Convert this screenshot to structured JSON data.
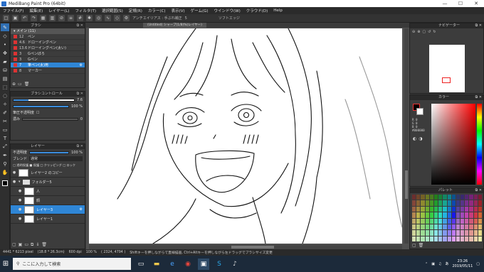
{
  "window": {
    "title": "MediBang Paint Pro (64bit)",
    "minimize": "—",
    "maximize": "☐",
    "close": "✕"
  },
  "menu": [
    "ファイル(F)",
    "編集(E)",
    "レイヤー(L)",
    "フィルタ(T)",
    "選択範囲(S)",
    "定規(R)",
    "カラー(C)",
    "表示(V)",
    "ゲーム(G)",
    "ウインドウ(W)",
    "クラウド(D)",
    "Help"
  ],
  "toolbar": {
    "antialias_label": "アンチエイリアス : 手ぶれ補正",
    "antialias_value": "5",
    "soft_edge_label": "ソフトエッジ"
  },
  "canvas": {
    "tab_label": "(Untitled) シャープ(1/8)%(レイヤー)"
  },
  "brush_panel": {
    "title": "ブラシ",
    "folder": "メイン (11)",
    "items": [
      {
        "size": "12",
        "name": "ペン"
      },
      {
        "size": "4.6",
        "name": "ドローイングペン"
      },
      {
        "size": "13.6",
        "name": "ドローイングペン(太い)"
      },
      {
        "size": "3",
        "name": "Gペンぼろ"
      },
      {
        "size": "3",
        "name": "Gペン"
      },
      {
        "size": "7",
        "name": "筆ペン(太)用"
      },
      {
        "size": "8",
        "name": "マーカー"
      }
    ]
  },
  "brush_control": {
    "title": "ブラシコントロール",
    "size_value": "7.6",
    "opacity_value": "100 %",
    "pressure_label": "筆圧不透明度",
    "thickness_label": "濃み",
    "thickness_value": "0",
    "size_fill": 0.25,
    "opacity_fill": 1.0
  },
  "layer_panel": {
    "title": "レイヤー",
    "opacity_label": "不透明度",
    "opacity_value": "100 %",
    "blend_label": "ブレンド",
    "blend_value": "通常",
    "options": "□ 透明保護  ■ 保護  □ クリッピング  □ ロック",
    "layers": [
      {
        "name": "レイヤー2 のコピー",
        "selected": false
      },
      {
        "name": "フォルダー5",
        "selected": false
      },
      {
        "name": "人",
        "selected": false
      },
      {
        "name": "顔",
        "selected": false
      },
      {
        "name": "レイヤー3",
        "selected": true
      },
      {
        "name": "レイヤー1",
        "selected": false
      }
    ]
  },
  "navigator": {
    "title": "ナビゲーター"
  },
  "color_panel": {
    "title": "カラー",
    "values": "R 0\nG 0\nB 0\n#000000"
  },
  "palette_panel": {
    "title": "パレット"
  },
  "status": {
    "dimensions": "4441 * 6213 pixel",
    "size_cm": "(18.8 * 26.3cm)",
    "dpi": "600 dpi",
    "zoom": "100 %",
    "coords": "( 2324, 4794 )",
    "hint": "Shiftキーを押しながらで直線描画, Ctrl+Altキーを押しながら左ドラッグでブラシサイズ変更"
  },
  "taskbar": {
    "search_placeholder": "ここに入力して検索",
    "time": "23:26",
    "date": "2019/05/11"
  },
  "colors": {
    "accent": "#2f86d6",
    "taskbar": "#1c2a3a"
  }
}
